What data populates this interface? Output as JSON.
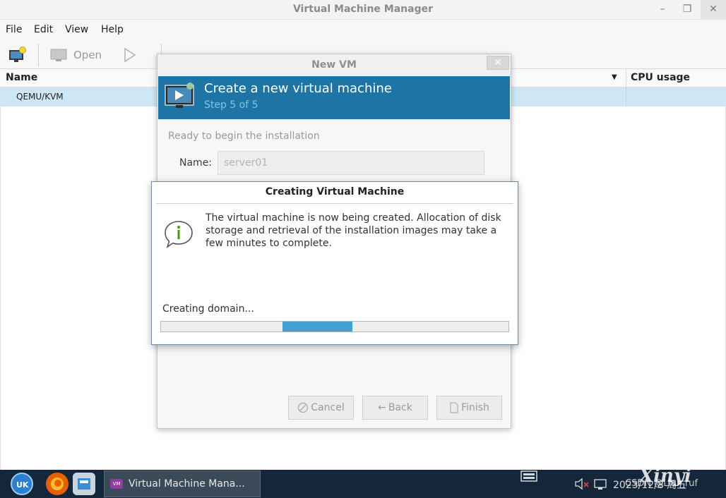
{
  "window": {
    "title": "Virtual Machine Manager"
  },
  "menu": {
    "items": [
      "File",
      "Edit",
      "View",
      "Help"
    ]
  },
  "toolbar": {
    "open_label": "Open"
  },
  "columns": {
    "name": "Name",
    "cpu": "CPU usage"
  },
  "connections": [
    {
      "label": "QEMU/KVM",
      "selected": true
    }
  ],
  "new_vm_dialog": {
    "title": "New VM",
    "banner_title": "Create a new virtual machine",
    "step": "Step 5 of 5",
    "ready_text": "Ready to begin the installation",
    "name_label": "Name:",
    "name_value": "server01",
    "cancel_label": "Cancel",
    "back_label": "Back",
    "finish_label": "Finish"
  },
  "creating_dialog": {
    "title": "Creating Virtual Machine",
    "message": "The virtual machine is now being created. Allocation of disk storage and retrieval of the installation images may take a few minutes to complete.",
    "status": "Creating domain...",
    "progress_fill_start": 0.35,
    "progress_fill_end": 0.55
  },
  "taskbar": {
    "window_label": "Virtual Machine Mana...",
    "clock": "2023/12/8 周五",
    "watermark": "Xinyi",
    "watermark_sub": "CSDN @Liar_ruf"
  },
  "colors": {
    "banner": "#1d74a5",
    "selection": "#cde8f4",
    "progress": "#3fa2d2",
    "taskbar": "#14263a"
  }
}
